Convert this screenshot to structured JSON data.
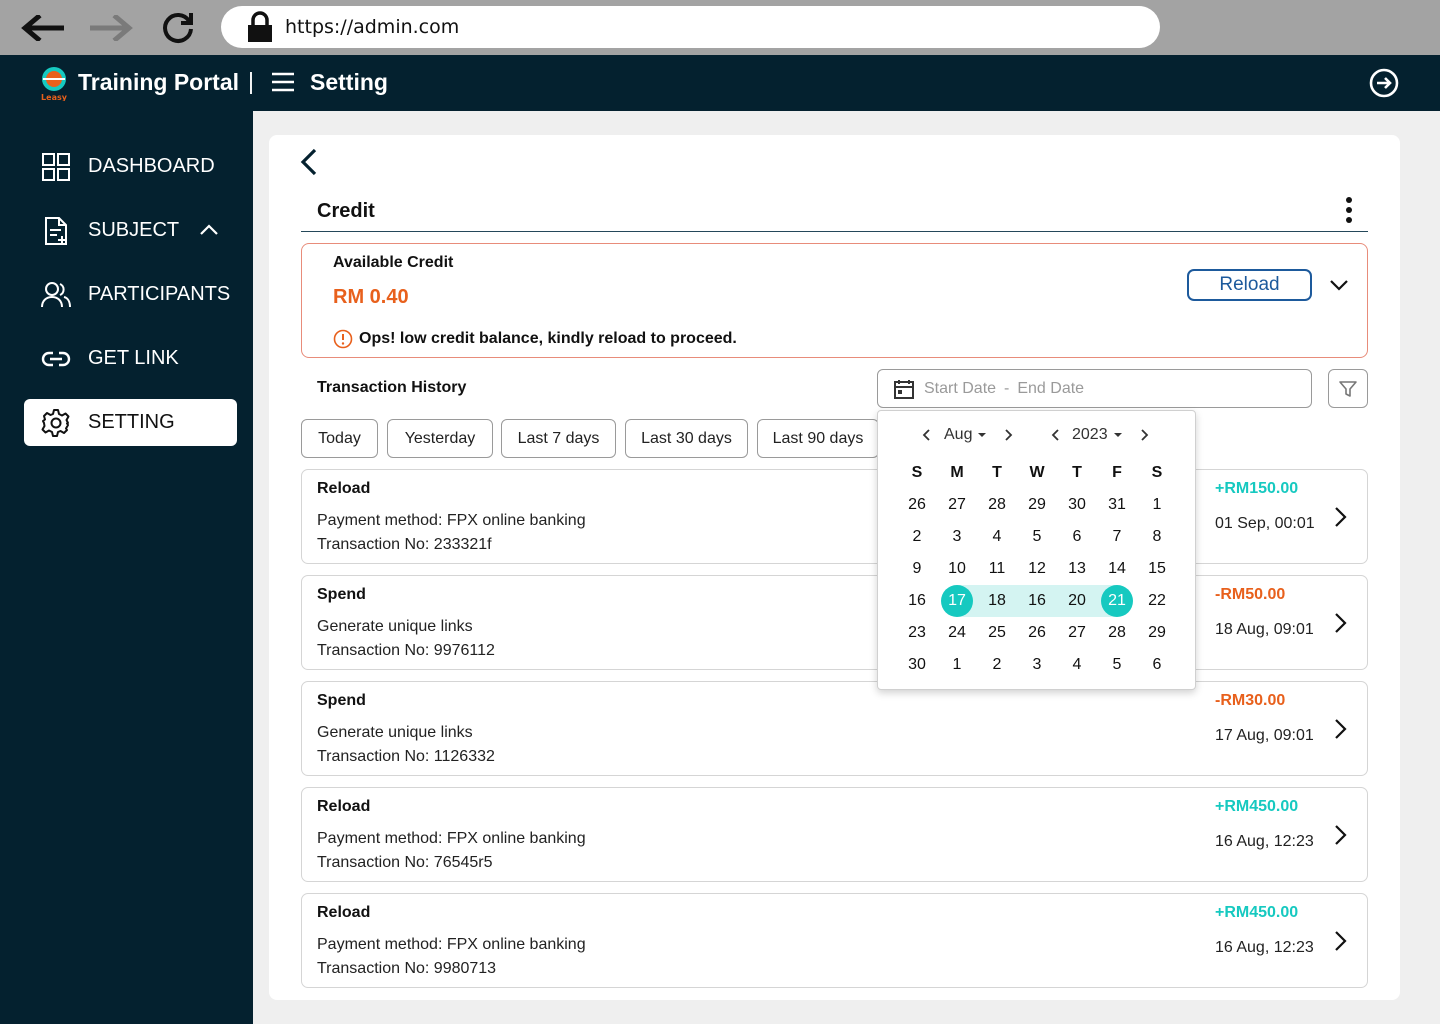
{
  "browser": {
    "url": "https://admin.com"
  },
  "header": {
    "app_title": "Training Portal",
    "separator": "|",
    "page_title": "Setting",
    "logo_text": "Leasy"
  },
  "sidebar": {
    "items": [
      {
        "label": "DASHBOARD",
        "icon": "dashboard-icon"
      },
      {
        "label": "SUBJECT",
        "icon": "document-icon"
      },
      {
        "label": "PARTICIPANTS",
        "icon": "users-icon"
      },
      {
        "label": "GET LINK",
        "icon": "link-icon"
      },
      {
        "label": "SETTING",
        "icon": "gear-icon",
        "active": true
      }
    ]
  },
  "credit": {
    "title": "Credit",
    "available_label": "Available Credit",
    "amount": "RM 0.40",
    "warning": "Ops! low credit balance, kindly reload to proceed.",
    "reload_label": "Reload"
  },
  "transactions": {
    "title": "Transaction History",
    "start_placeholder": "Start Date",
    "range_separator": "-",
    "end_placeholder": "End Date",
    "quick_filters": [
      "Today",
      "Yesterday",
      "Last 7 days",
      "Last 30 days",
      "Last 90 days"
    ],
    "rows": [
      {
        "type": "Reload",
        "desc": "Payment method: FPX online banking",
        "txn": "Transaction No: 233321f",
        "amount": "+RM150.00",
        "sign": "pos",
        "date": "01 Sep, 00:01"
      },
      {
        "type": "Spend",
        "desc": "Generate unique links",
        "txn": "Transaction No: 9976112",
        "amount": "-RM50.00",
        "sign": "neg",
        "date": "18 Aug, 09:01"
      },
      {
        "type": "Spend",
        "desc": "Generate unique links",
        "txn": "Transaction No: 1126332",
        "amount": "-RM30.00",
        "sign": "neg",
        "date": "17 Aug, 09:01"
      },
      {
        "type": "Reload",
        "desc": "Payment method: FPX online banking",
        "txn": "Transaction No: 76545r5",
        "amount": "+RM450.00",
        "sign": "pos",
        "date": "16 Aug, 12:23"
      },
      {
        "type": "Reload",
        "desc": "Payment method: FPX online banking",
        "txn": "Transaction No: 9980713",
        "amount": "+RM450.00",
        "sign": "pos",
        "date": "16 Aug, 12:23"
      }
    ]
  },
  "calendar": {
    "month": "Aug",
    "year": "2023",
    "weekdays": [
      "S",
      "M",
      "T",
      "W",
      "T",
      "F",
      "S"
    ],
    "weeks": [
      [
        "26",
        "27",
        "28",
        "29",
        "30",
        "31",
        "1"
      ],
      [
        "2",
        "3",
        "4",
        "5",
        "6",
        "7",
        "8"
      ],
      [
        "9",
        "10",
        "11",
        "12",
        "13",
        "14",
        "15"
      ],
      [
        "16",
        "17",
        "18",
        "16",
        "20",
        "21",
        "22"
      ],
      [
        "23",
        "24",
        "25",
        "26",
        "27",
        "28",
        "29"
      ],
      [
        "30",
        "1",
        "2",
        "3",
        "4",
        "5",
        "6"
      ]
    ],
    "range_start": "17",
    "range_end": "21",
    "accent_color": "#16c9c0"
  },
  "colors": {
    "navy": "#04212f",
    "teal": "#16c9c0",
    "orange": "#e8601c",
    "reload_blue": "#1d5a9c"
  }
}
